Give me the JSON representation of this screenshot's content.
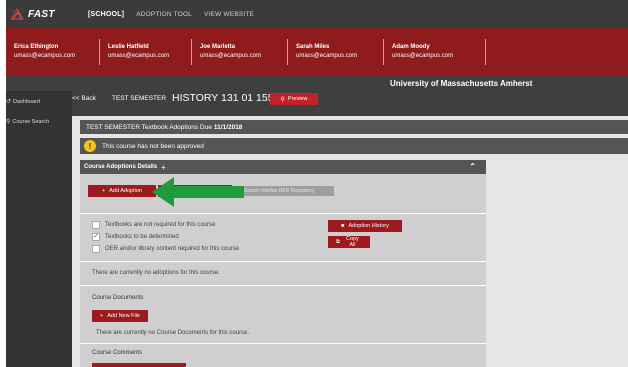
{
  "topnav": {
    "logo_text": "FAST",
    "items": [
      {
        "label": "[SCHOOL]",
        "active": true
      },
      {
        "label": "ADOPTION TOOL",
        "active": false
      },
      {
        "label": "VIEW WEBSITE",
        "active": false
      }
    ]
  },
  "users": [
    {
      "name": "Erica Ethington",
      "email": "umass@ecampus.com"
    },
    {
      "name": "Leslie Hatfield",
      "email": "umass@ecampus.com"
    },
    {
      "name": "Joe Marletta",
      "email": "umass@ecampus.com"
    },
    {
      "name": "Sarah Miles",
      "email": "umass@ecampus.com"
    },
    {
      "name": "Adam Moody",
      "email": "umass@ecampus.com"
    }
  ],
  "subheader": {
    "university": "University of Massachusetts Amherst",
    "back": "<< Back",
    "semester": "TEST SEMESTER",
    "course": "HISTORY 131 01 15501",
    "preview": "Preview"
  },
  "sidebar": {
    "dashboard": "Dashboard",
    "course_search": "Course Search"
  },
  "main": {
    "due_prefix": "TEST SEMESTER Textbook Adoptions Due",
    "due_date": "11/1/2018",
    "approval_status": "This course has not been approved",
    "card_title": "Course Adoptions Details",
    "add_adoption": "Add Adoption",
    "oer_search": "Search Intellus OER Repository",
    "checkboxes": [
      {
        "label": "Textbooks are not required for this course",
        "checked": false
      },
      {
        "label": "Textbooks to be determined",
        "checked": true
      },
      {
        "label": "OER and/or library content required for this course",
        "checked": false
      }
    ],
    "adoption_history": "Adoption History",
    "copy_all": "Copy All",
    "no_adoptions": "There are currently no adoptions for this course.",
    "documents_title": "Course Documents",
    "add_new_file": "Add New File",
    "no_documents": "There are currently no Course Documents for this course.",
    "comments_title": "Course Comments"
  },
  "colors": {
    "brand_red": "#8f1c1c",
    "button_red": "#9b1b1f",
    "arrow_green": "#1f9a3c",
    "warning_yellow": "#f3c21b"
  }
}
